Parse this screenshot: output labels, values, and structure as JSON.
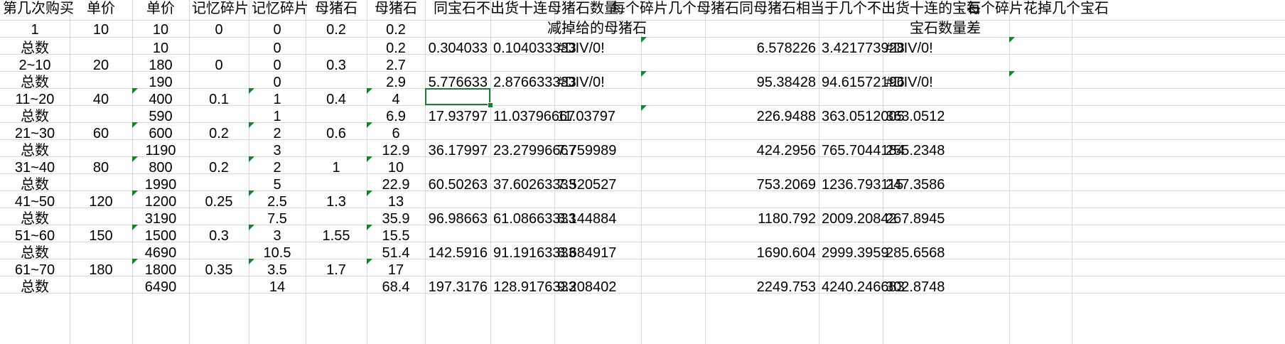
{
  "header": [
    "第几次购买",
    "单价",
    "单价",
    "记忆碎片",
    "记忆碎片",
    "母猪石",
    "母猪石",
    "同宝石不出货十连母猪石数量",
    "每个碎片几个母猪石",
    "同母猪石相当于几个不出货十连的宝石",
    "每个碎片花掉几个宝石"
  ],
  "subheader": {
    "h": "减掉给的母猪石",
    "k": "宝石数量差"
  },
  "rows": [
    {
      "a": "1",
      "b": "10",
      "c": "10",
      "d": "0",
      "e": "0",
      "f": "0.2",
      "g": "0.2",
      "h": "",
      "i": "",
      "j": "",
      "k": "",
      "l": "",
      "m": ""
    },
    {
      "a": "总数",
      "b": "",
      "c": "10",
      "d": "",
      "e": "0",
      "f": "",
      "g": "0.2",
      "h": "0.304033",
      "i": "0.104033333",
      "j": "#DIV/0!",
      "k": "6.578226",
      "l": "3.421773928",
      "m": "#DIV/0!"
    },
    {
      "a": "2~10",
      "b": "20",
      "c": "180",
      "d": "0",
      "e": "0",
      "f": "0.3",
      "g": "2.7",
      "h": "",
      "i": "",
      "j": "",
      "k": "",
      "l": "",
      "m": ""
    },
    {
      "a": "总数",
      "b": "",
      "c": "190",
      "d": "",
      "e": "0",
      "f": "",
      "g": "2.9",
      "h": "5.776633",
      "i": "2.876633333",
      "j": "#DIV/0!",
      "k": "95.38428",
      "l": "94.61572196",
      "m": "#DIV/0!"
    },
    {
      "a": "11~20",
      "b": "40",
      "c": "400",
      "d": "0.1",
      "e": "1",
      "f": "0.4",
      "g": "4",
      "h": "",
      "i": "",
      "j": "",
      "k": "",
      "l": "",
      "m": ""
    },
    {
      "a": "总数",
      "b": "",
      "c": "590",
      "d": "",
      "e": "1",
      "f": "",
      "g": "6.9",
      "h": "17.93797",
      "i": "11.03796667",
      "j": "11.03797",
      "k": "226.9488",
      "l": "363.0512005",
      "m": "363.0512"
    },
    {
      "a": "21~30",
      "b": "60",
      "c": "600",
      "d": "0.2",
      "e": "2",
      "f": "0.6",
      "g": "6",
      "h": "",
      "i": "",
      "j": "",
      "k": "",
      "l": "",
      "m": ""
    },
    {
      "a": "总数",
      "b": "",
      "c": "1190",
      "d": "",
      "e": "3",
      "f": "",
      "g": "12.9",
      "h": "36.17997",
      "i": "23.27996667",
      "j": "7.759989",
      "k": "424.2956",
      "l": "765.7044184",
      "m": "255.2348"
    },
    {
      "a": "31~40",
      "b": "80",
      "c": "800",
      "d": "0.2",
      "e": "2",
      "f": "1",
      "g": "10",
      "h": "",
      "i": "",
      "j": "",
      "k": "",
      "l": "",
      "m": ""
    },
    {
      "a": "总数",
      "b": "",
      "c": "1990",
      "d": "",
      "e": "5",
      "f": "",
      "g": "22.9",
      "h": "60.50263",
      "i": "37.60263333",
      "j": "7.520527",
      "k": "753.2069",
      "l": "1236.793115",
      "m": "247.3586"
    },
    {
      "a": "41~50",
      "b": "120",
      "c": "1200",
      "d": "0.25",
      "e": "2.5",
      "f": "1.3",
      "g": "13",
      "h": "",
      "i": "",
      "j": "",
      "k": "",
      "l": "",
      "m": ""
    },
    {
      "a": "总数",
      "b": "",
      "c": "3190",
      "d": "",
      "e": "7.5",
      "f": "",
      "g": "35.9",
      "h": "96.98663",
      "i": "61.08663333",
      "j": "8.144884",
      "k": "1180.792",
      "l": "2009.20842",
      "m": "267.8945"
    },
    {
      "a": "51~60",
      "b": "150",
      "c": "1500",
      "d": "0.3",
      "e": "3",
      "f": "1.55",
      "g": "15.5",
      "h": "",
      "i": "",
      "j": "",
      "k": "",
      "l": "",
      "m": ""
    },
    {
      "a": "总数",
      "b": "",
      "c": "4690",
      "d": "",
      "e": "10.5",
      "f": "",
      "g": "51.4",
      "h": "142.5916",
      "i": "91.19163333",
      "j": "8.684917",
      "k": "1690.604",
      "l": "2999.3959",
      "m": "285.6568"
    },
    {
      "a": "61~70",
      "b": "180",
      "c": "1800",
      "d": "0.35",
      "e": "3.5",
      "f": "1.7",
      "g": "17",
      "h": "",
      "i": "",
      "j": "",
      "k": "",
      "l": "",
      "m": ""
    },
    {
      "a": "总数",
      "b": "",
      "c": "6490",
      "d": "",
      "e": "14",
      "f": "",
      "g": "68.4",
      "h": "197.3176",
      "i": "128.9176333",
      "j": "9.208402",
      "k": "2249.753",
      "l": "4240.246683",
      "m": "302.8748"
    }
  ]
}
